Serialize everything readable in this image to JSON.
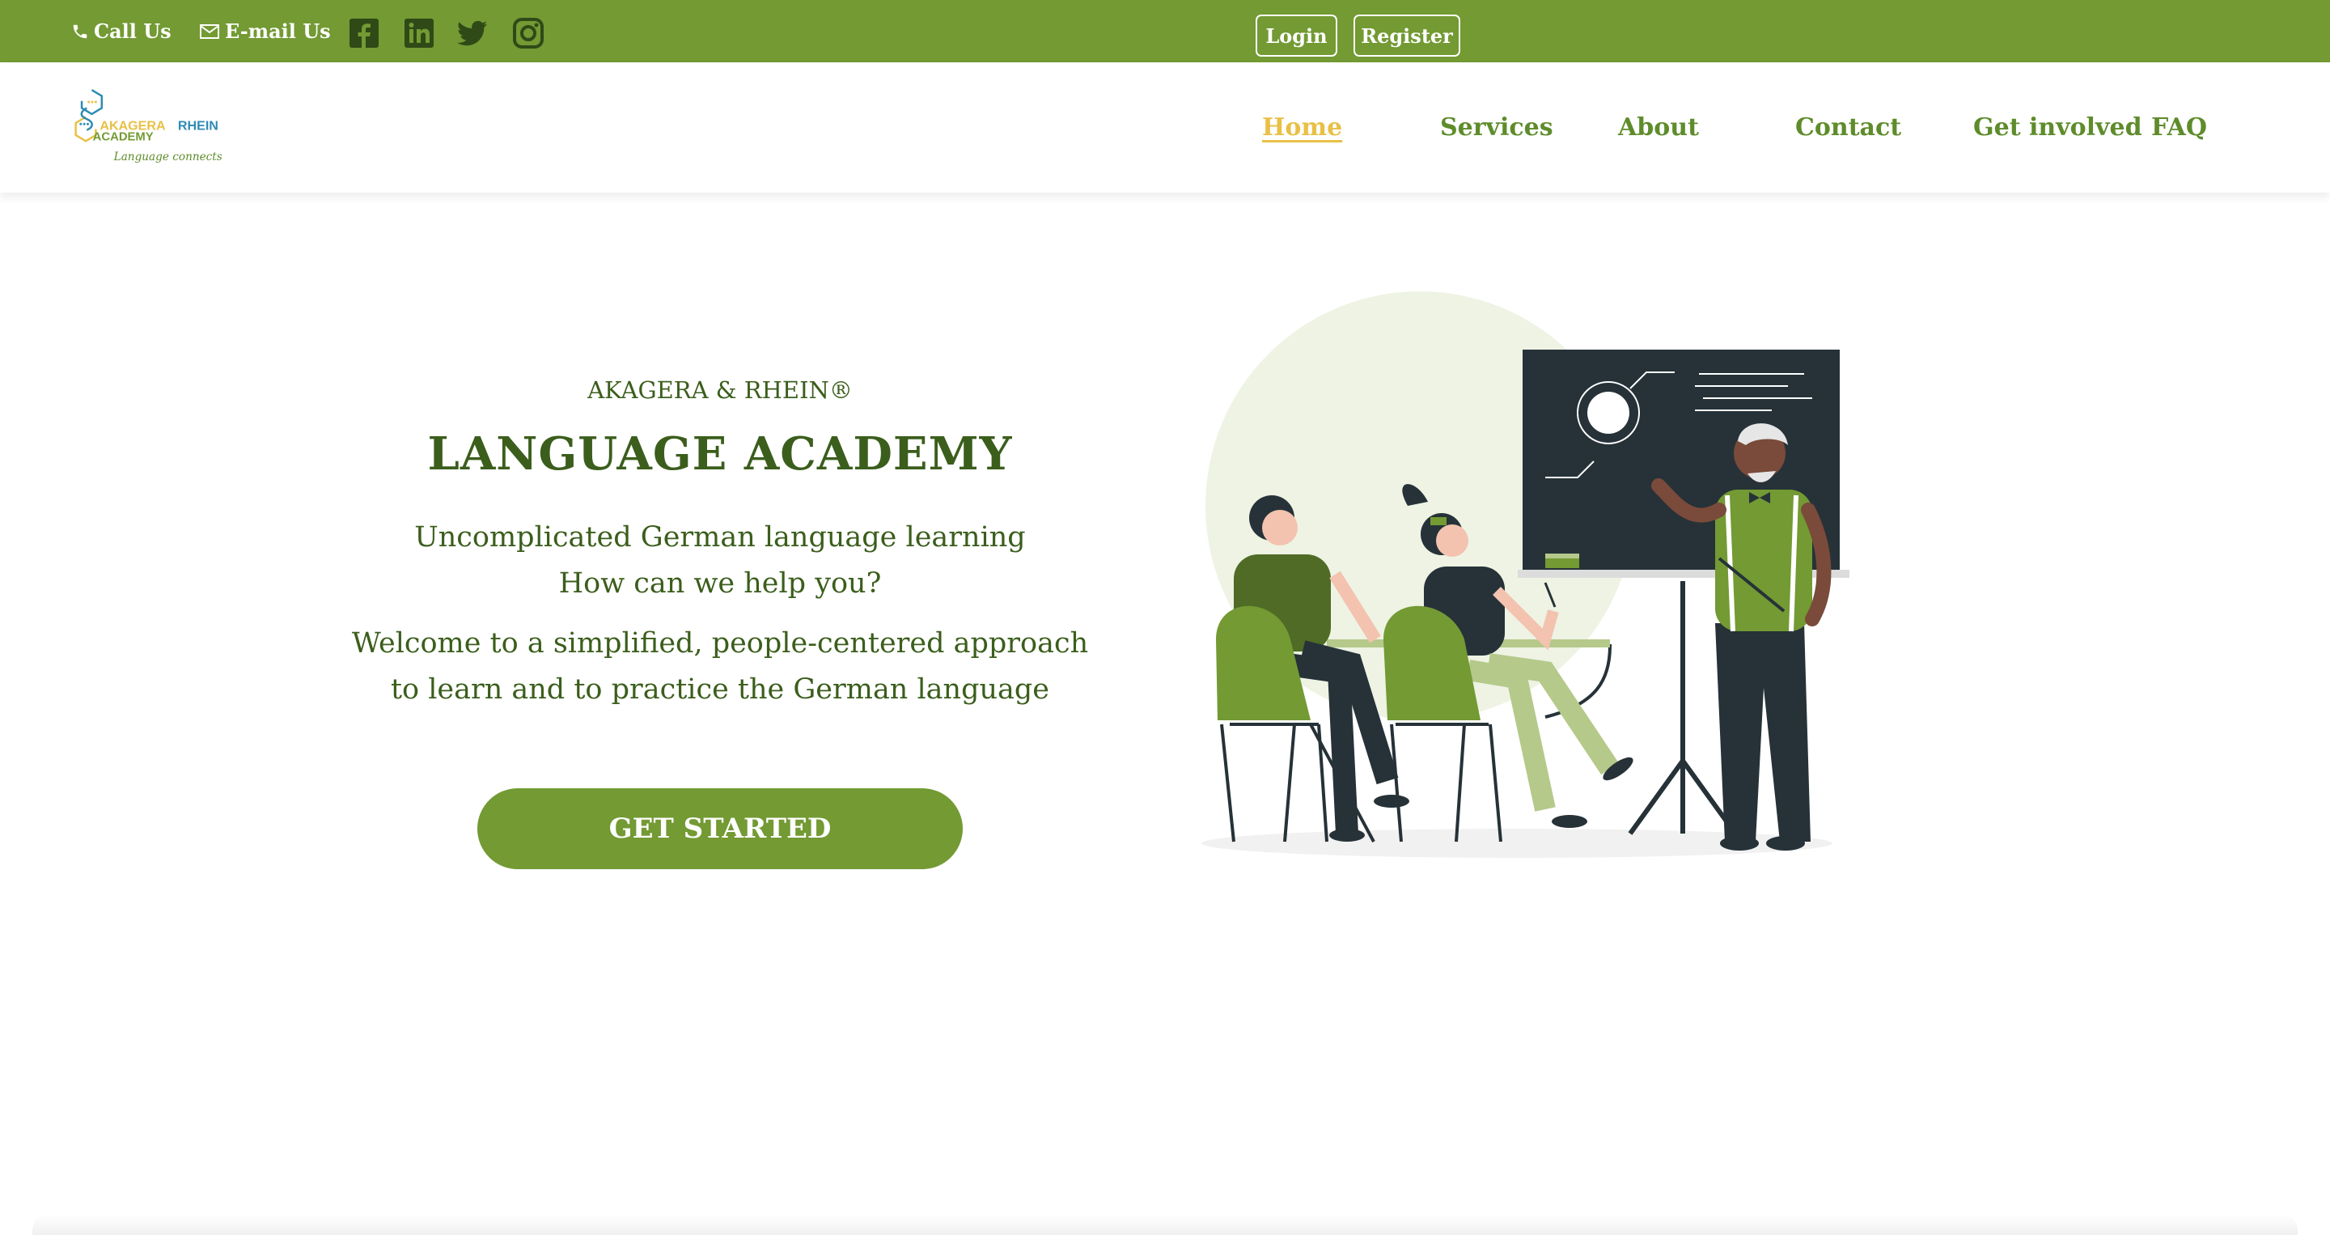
{
  "topbar": {
    "call_label": "Call Us",
    "email_label": "E-mail Us",
    "social": [
      "facebook-icon",
      "linkedin-icon",
      "twitter-icon",
      "instagram-icon"
    ],
    "login_label": "Login",
    "register_label": "Register"
  },
  "logo": {
    "word1": "AKAGERA",
    "word2": "RHEIN",
    "word3": "ACADEMY",
    "slogan": "Language connects"
  },
  "nav": {
    "items": [
      {
        "label": "Home",
        "active": true
      },
      {
        "label": "Services",
        "active": false
      },
      {
        "label": "About",
        "active": false
      },
      {
        "label": "Contact",
        "active": false
      },
      {
        "label": "Get involved",
        "active": false
      },
      {
        "label": "FAQ",
        "active": false
      }
    ]
  },
  "hero": {
    "eyebrow": "AKAGERA & RHEIN®",
    "title": "LANGUAGE ACADEMY",
    "tagline_1": "Uncomplicated German language learning",
    "tagline_2": "How can we help you?",
    "welcome_1": "Welcome to a simplified, people-centered approach",
    "welcome_2": "to learn and to practice the German language",
    "cta_label": "GET STARTED"
  },
  "colors": {
    "brand_green": "#739a33",
    "heading_green": "#3b5e1c",
    "nav_green": "#5e8c2b",
    "active_yellow": "#e9c046",
    "logo_blue": "#2e8bb5"
  }
}
